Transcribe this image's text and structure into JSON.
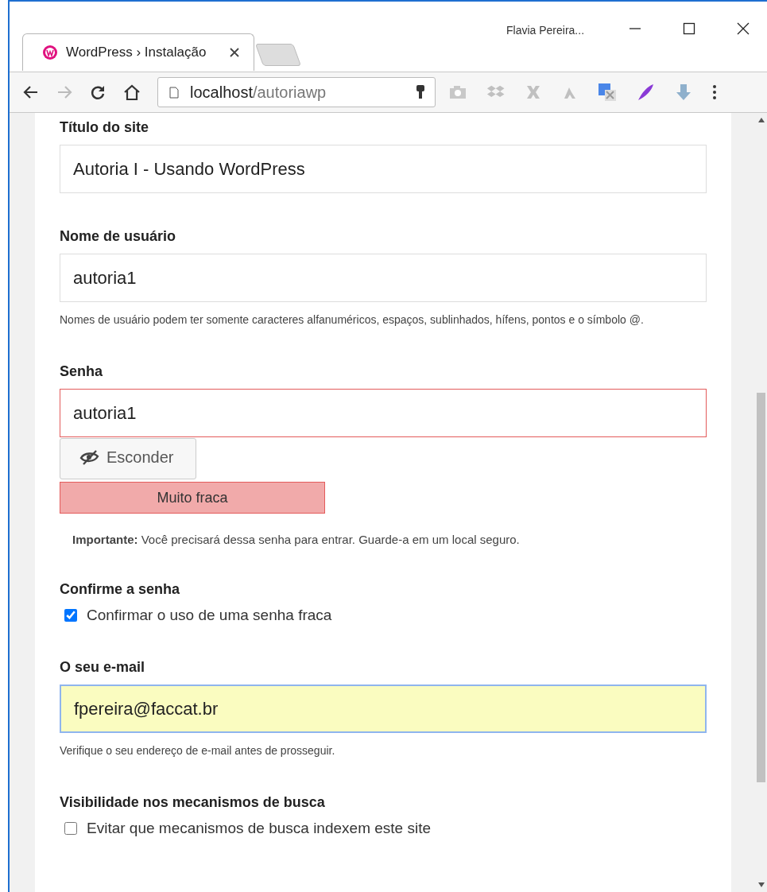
{
  "window": {
    "user": "Flavia Pereira...",
    "tabs": [
      {
        "title": "WordPress › Instalação",
        "selected": true
      }
    ]
  },
  "address": {
    "host": "localhost",
    "path": "/autoriawp"
  },
  "form": [
    {
      "kind": "text",
      "label": "Título do site",
      "value": "Autoria I - Usando WordPress"
    },
    {
      "kind": "text",
      "label": "Nome de usuário",
      "value": "autoria1",
      "hint": "Nomes de usuário podem ter somente caracteres alfanuméricos, espaços, sublinhados, hífens, pontos e o símbolo @."
    },
    {
      "kind": "password",
      "label": "Senha",
      "value": "autoria1",
      "button": "Esconder",
      "strength": "Muito fraca",
      "weak": true,
      "note": "**Importante:** Você precisará dessa senha para entrar. Guarde-a em um local seguro."
    },
    {
      "kind": "checkbox",
      "label": "Confirme a senha",
      "option": "Confirmar o uso de uma senha fraca",
      "checked": true
    },
    {
      "kind": "email",
      "label": "O seu e-mail",
      "value": "fpereira@faccat.br",
      "focused": true,
      "hint": "Verifique o seu endereço de e-mail antes de prosseguir."
    },
    {
      "kind": "checkbox",
      "label": "Visibilidade nos mecanismos de busca",
      "option": "Evitar que mecanismos de busca indexem este site",
      "checked": false
    }
  ]
}
